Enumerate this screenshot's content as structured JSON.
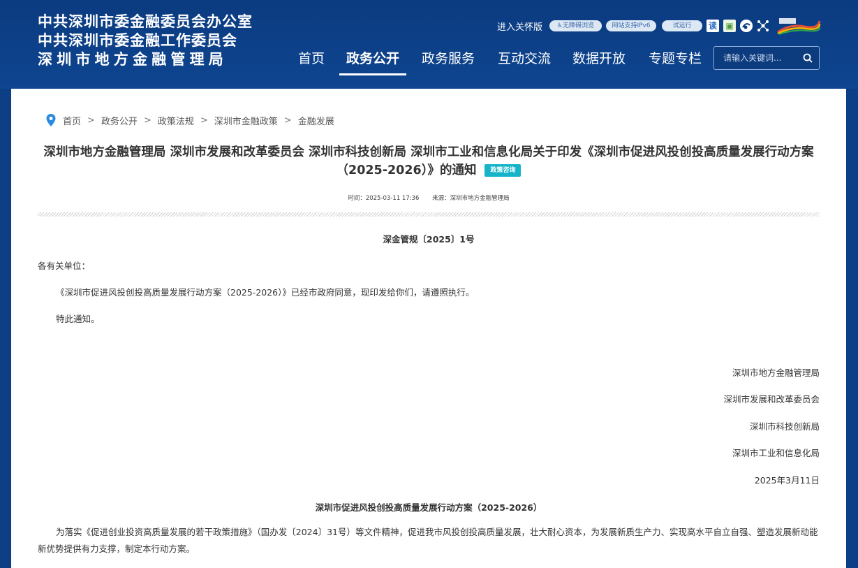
{
  "header": {
    "org_line1": "中共深圳市委金融委员会办公室",
    "org_line2": "中共深圳市委金融工作委员会",
    "org_line3": "深圳市地方金融管理局",
    "care_mode": "进入关怀版",
    "accessibility": "无障碍浏览",
    "ipv6": "网站支持IPv6",
    "trial": "试运行",
    "nav": [
      "首页",
      "政务公开",
      "政务服务",
      "互动交流",
      "数据开放",
      "专题专栏"
    ],
    "nav_active": "政务公开",
    "search_placeholder": "请输入关键词..."
  },
  "breadcrumb": [
    "首页",
    "政务公开",
    "政策法规",
    "深圳市金融政策",
    "金融发展"
  ],
  "article": {
    "title": "深圳市地方金融管理局 深圳市发展和改革委员会 深圳市科技创新局 深圳市工业和信息化局关于印发《深圳市促进风投创投高质量发展行动方案（2025-2026）》的通知",
    "badge": "政策咨询",
    "time": "时间：2025-03-11 17:36",
    "source": "来源：深圳市地方金融管理局",
    "doc_no": "深金管规〔2025〕1号",
    "salutation": "各有关单位：",
    "body1": "《深圳市促进风投创投高质量发展行动方案（2025-2026）》已经市政府同意，现印发给你们，请遵照执行。",
    "body2": "特此通知。",
    "signatories": [
      "深圳市地方金融管理局",
      "深圳市发展和改革委员会",
      "深圳市科技创新局",
      "深圳市工业和信息化局"
    ],
    "date": "2025年3月11日",
    "plan_title": "深圳市促进风投创投高质量发展行动方案（2025-2026）",
    "plan_intro": "为落实《促进创业投资高质量发展的若干政策措施》（国办发〔2024〕31号）等文件精神，促进我市风投创投高质量发展，壮大耐心资本，为发展新质生产力、实现高水平自立自强、塑造发展新动能新优势提供有力支撑，制定本行动方案。"
  },
  "colors": {
    "header_bg": "#0d3f86",
    "badge_bg": "#16b3c9"
  }
}
